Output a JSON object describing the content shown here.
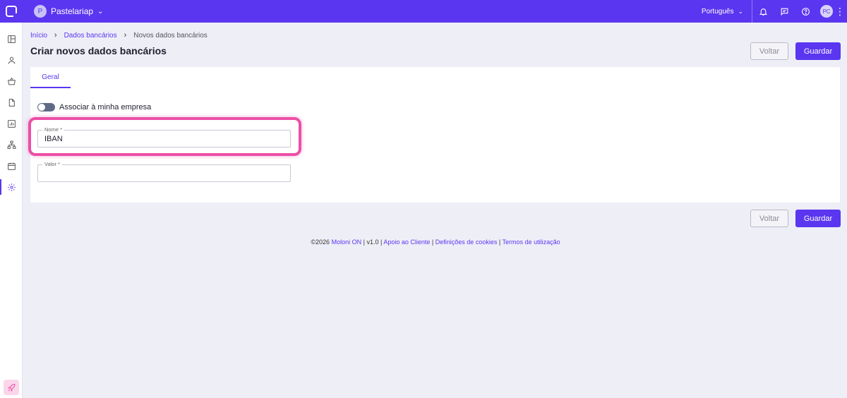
{
  "topbar": {
    "company_initial": "P",
    "company_name": "Pastelariap",
    "language": "Português",
    "user_initials": "PC"
  },
  "breadcrumb": {
    "home": "Início",
    "section": "Dados bancários",
    "current": "Novos dados bancários"
  },
  "page": {
    "title": "Criar novos dados bancários",
    "back_label": "Voltar",
    "save_label": "Guardar"
  },
  "tabs": [
    {
      "label": "Geral",
      "active": true
    }
  ],
  "form": {
    "toggle_label": "Associar à minha empresa",
    "name_label": "Nome *",
    "name_value": "IBAN",
    "value_label": "Valor *",
    "value_value": ""
  },
  "footer": {
    "copyright": "©2026",
    "brand": "Moloni ON",
    "version": "v1.0",
    "support": "Apoio ao Cliente",
    "cookies": "Definições de cookies",
    "terms": "Termos de utilização",
    "separator": "|"
  },
  "colors": {
    "primary": "#5a36f0",
    "highlight": "#ec4fa6",
    "background": "#eeeef7"
  },
  "icons": {
    "sidebar": [
      "dashboard-icon",
      "user-icon",
      "basket-icon",
      "document-icon",
      "chart-icon",
      "hierarchy-icon",
      "calendar-icon",
      "gear-icon"
    ],
    "topbar": [
      "bell-icon",
      "chat-icon",
      "help-icon"
    ]
  }
}
